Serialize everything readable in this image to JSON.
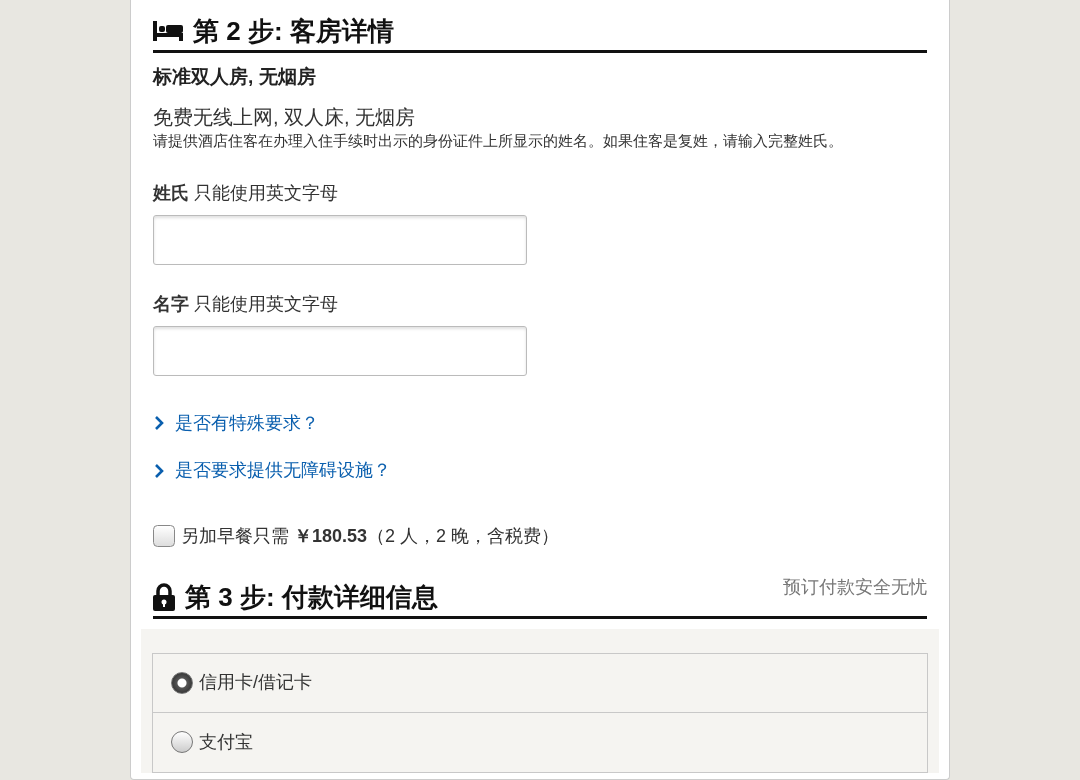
{
  "step2": {
    "title": "第 2 步: 客房详情",
    "room_name": "标准双人房, 无烟房",
    "features": "免费无线上网, 双人床, 无烟房",
    "note": "请提供酒店住客在办理入住手续时出示的身份证件上所显示的姓名。如果住客是复姓，请输入完整姓氏。",
    "fields": [
      {
        "label": "姓氏",
        "hint": "只能使用英文字母"
      },
      {
        "label": "名字",
        "hint": "只能使用英文字母"
      }
    ],
    "links": [
      "是否有特殊要求？",
      "是否要求提供无障碍设施？"
    ],
    "breakfast": {
      "text": "另加早餐只需 **￥180.53**（2 人，2 晚，含税费）",
      "checked": false
    }
  },
  "step3": {
    "title": "第 3 步: 付款详细信息",
    "secure_note": "预订付款安全无忧",
    "payment_options": [
      {
        "label": "信用卡/借记卡",
        "selected": true
      },
      {
        "label": "支付宝",
        "selected": false
      }
    ]
  }
}
